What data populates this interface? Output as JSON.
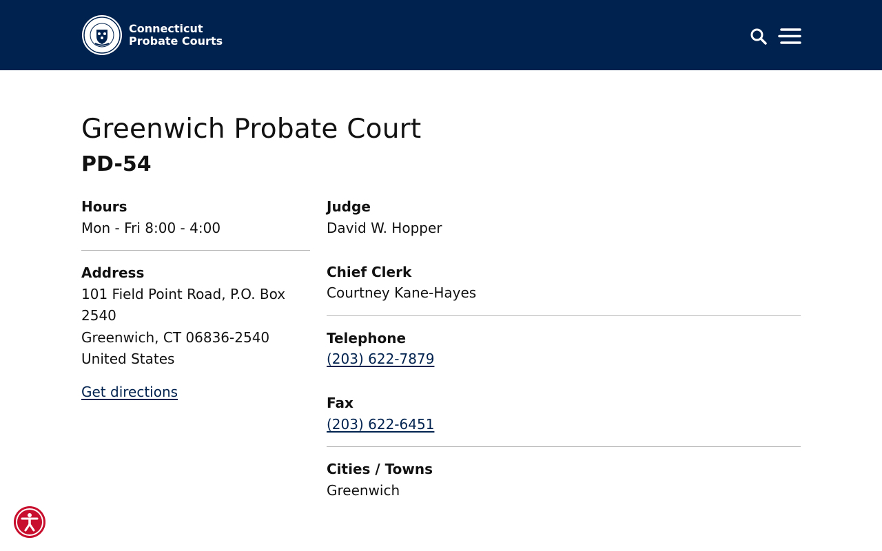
{
  "header": {
    "brand_line1": "Connecticut",
    "brand_line2": "Probate Courts",
    "seal_text": "CONNECTICUT PROBATE COURTS",
    "search_icon": "search-icon",
    "menu_icon": "hamburger-menu-icon",
    "background_color": "#00224f"
  },
  "court": {
    "title": "Greenwich Probate Court",
    "code": "PD-54"
  },
  "details": {
    "hours_label": "Hours",
    "hours_value": "Mon - Fri 8:00 - 4:00",
    "address_label": "Address",
    "address_line1": "101 Field Point Road, P.O. Box",
    "address_line2": "2540",
    "address_line3": "Greenwich, CT 06836-2540",
    "address_line4": "United States",
    "directions_link": "Get directions",
    "judge_label": "Judge",
    "judge_value": "David W. Hopper",
    "clerk_label": "Chief Clerk",
    "clerk_value": "Courtney Kane-Hayes",
    "telephone_label": "Telephone",
    "telephone_value": "(203) 622-7879",
    "fax_label": "Fax",
    "fax_value": "(203) 622-6451",
    "towns_label": "Cities / Towns",
    "towns_value": "Greenwich"
  },
  "accessibility": {
    "icon": "accessibility-icon",
    "color": "#c8102e"
  }
}
